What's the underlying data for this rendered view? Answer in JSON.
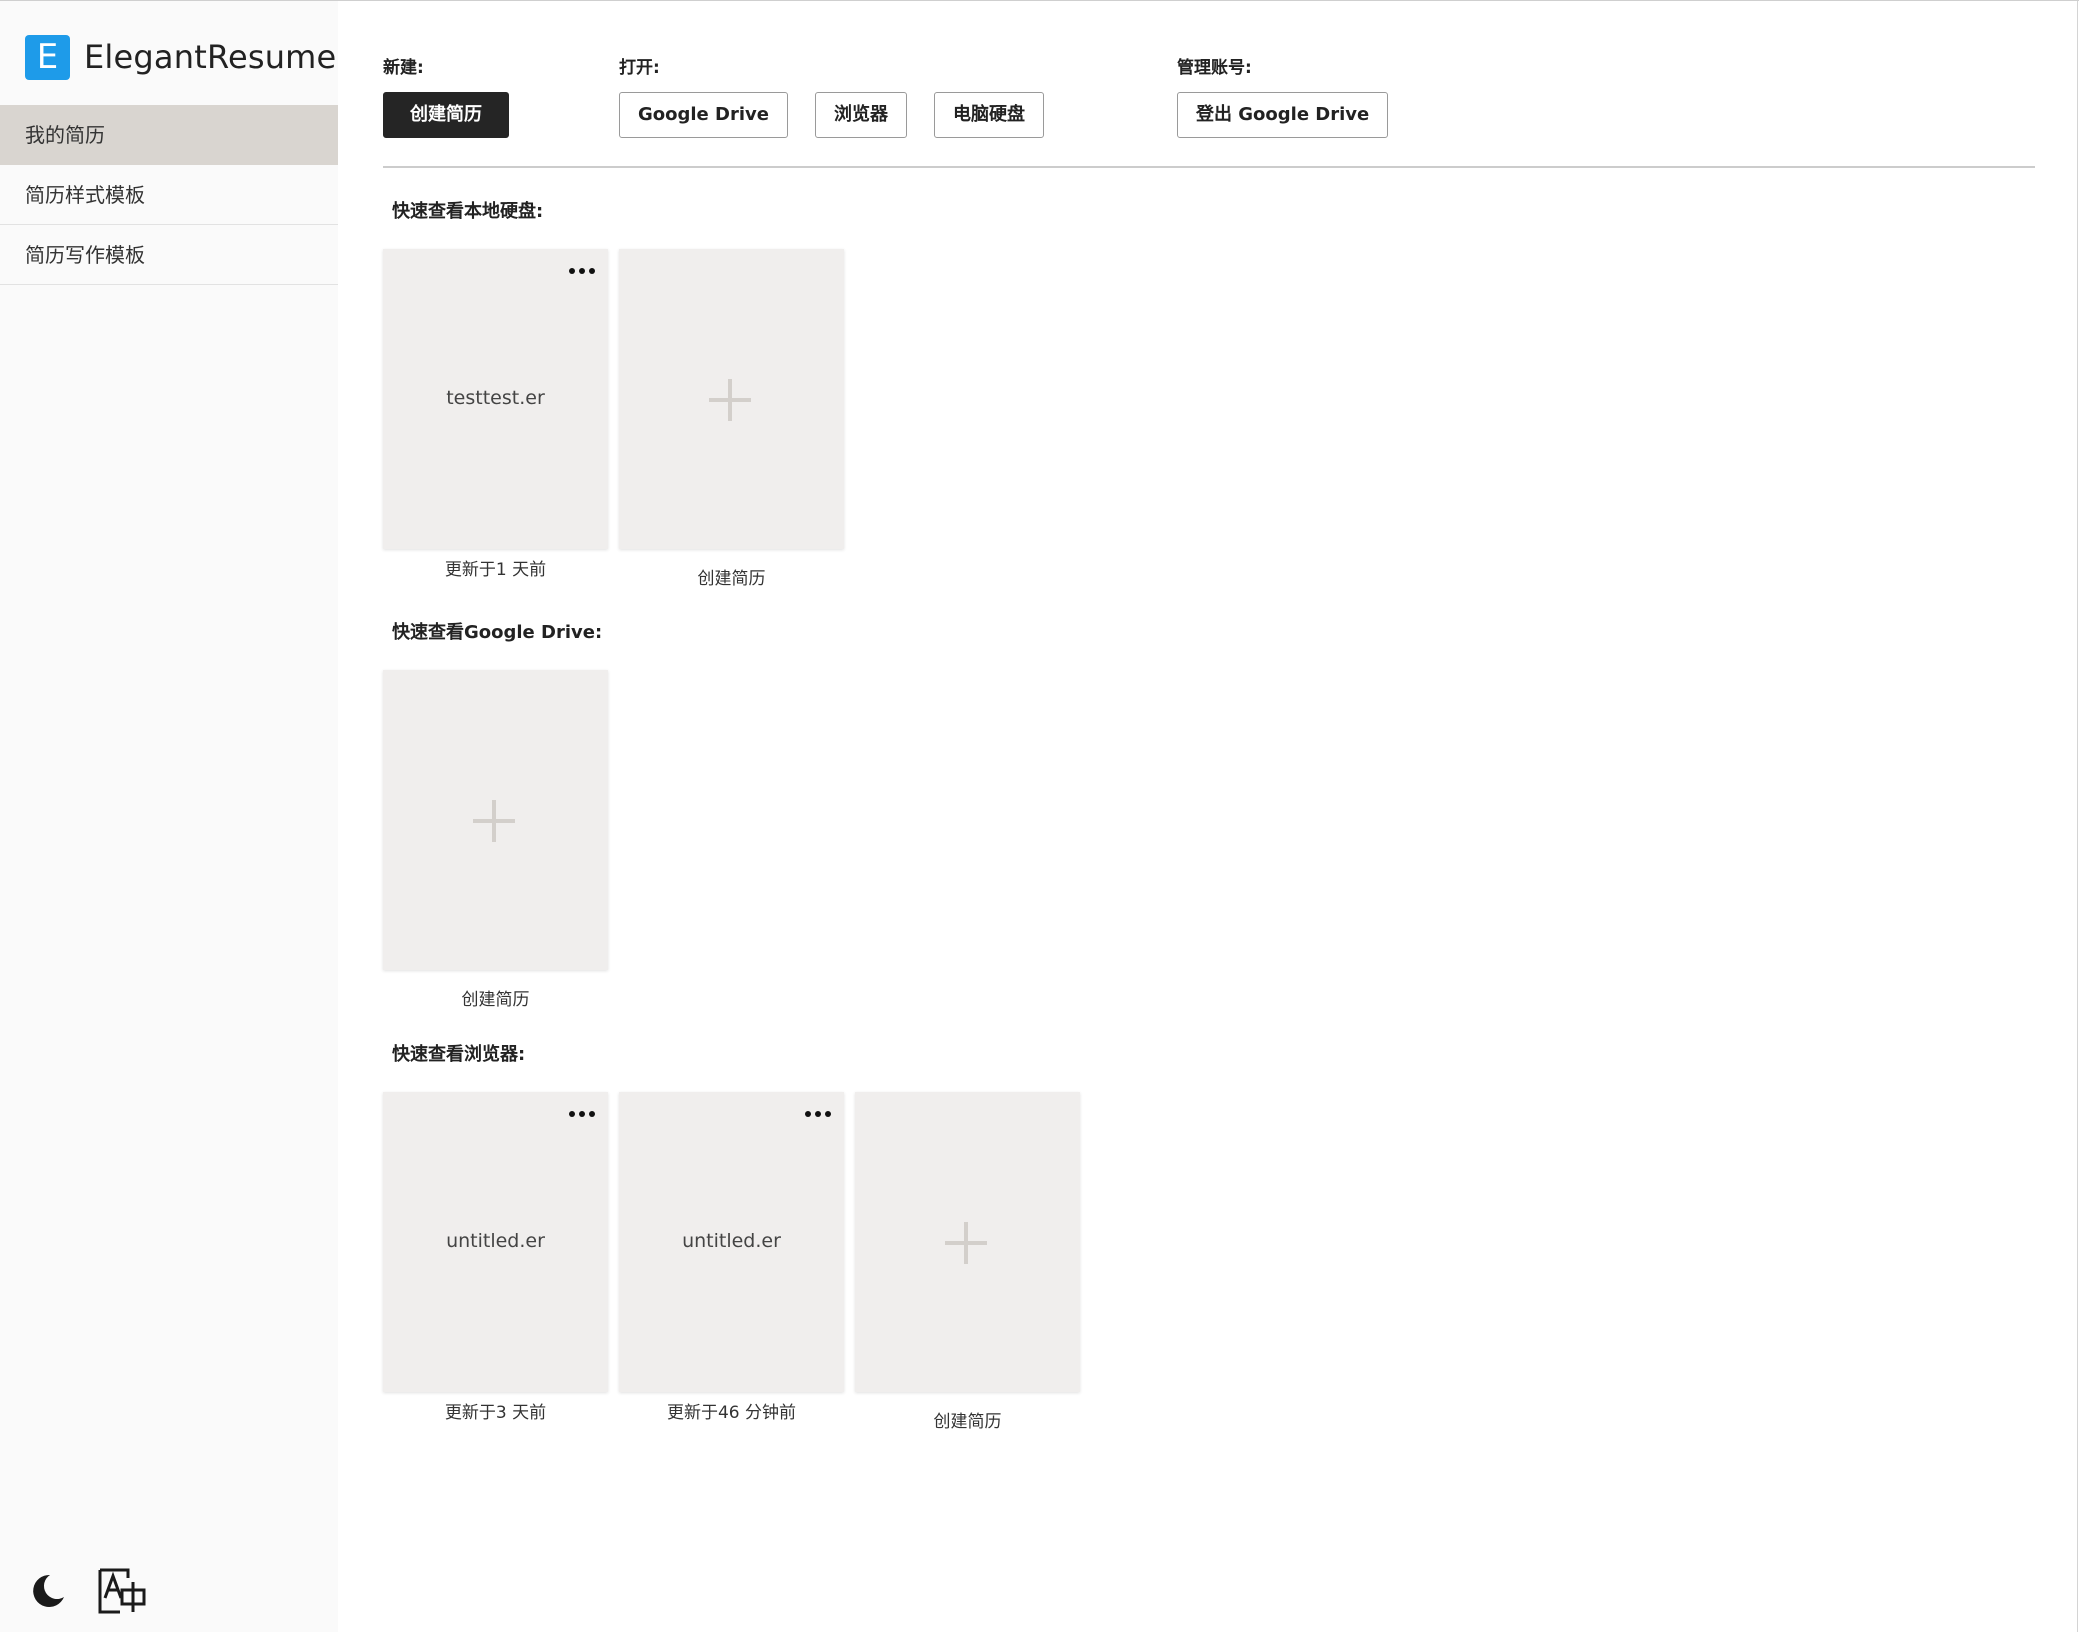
{
  "brand": {
    "logo_letter": "E",
    "name": "ElegantResume",
    "accent": "#1e9be9"
  },
  "sidebar": {
    "items": [
      {
        "label": "我的简历",
        "active": true
      },
      {
        "label": "简历样式模板",
        "active": false
      },
      {
        "label": "简历写作模板",
        "active": false
      }
    ],
    "bottom_icons": [
      "moon-icon",
      "translate-icon"
    ]
  },
  "toolbar": {
    "new": {
      "label": "新建:",
      "create_button": "创建简历"
    },
    "open": {
      "label": "打开:",
      "google_drive": "Google Drive",
      "browser": "浏览器",
      "local_disk": "电脑硬盘"
    },
    "account": {
      "label": "管理账号:",
      "logout_button": "登出 Google Drive"
    }
  },
  "sections": {
    "local": {
      "title": "快速查看本地硬盘:",
      "files": [
        {
          "name": "testtest.er",
          "updated": "更新于1 天前"
        }
      ],
      "new_label": "创建简历"
    },
    "gdrive": {
      "title": "快速查看Google Drive:",
      "files": [],
      "new_label": "创建简历"
    },
    "browser": {
      "title": "快速查看浏览器:",
      "files": [
        {
          "name": "untitled.er",
          "updated": "更新于3 天前"
        },
        {
          "name": "untitled.er",
          "updated": "更新于46 分钟前"
        }
      ],
      "new_label": "创建简历"
    }
  },
  "colors": {
    "card_bg": "#f0eeed",
    "active_nav_bg": "#d9d5d0",
    "dark_button": "#252525"
  }
}
